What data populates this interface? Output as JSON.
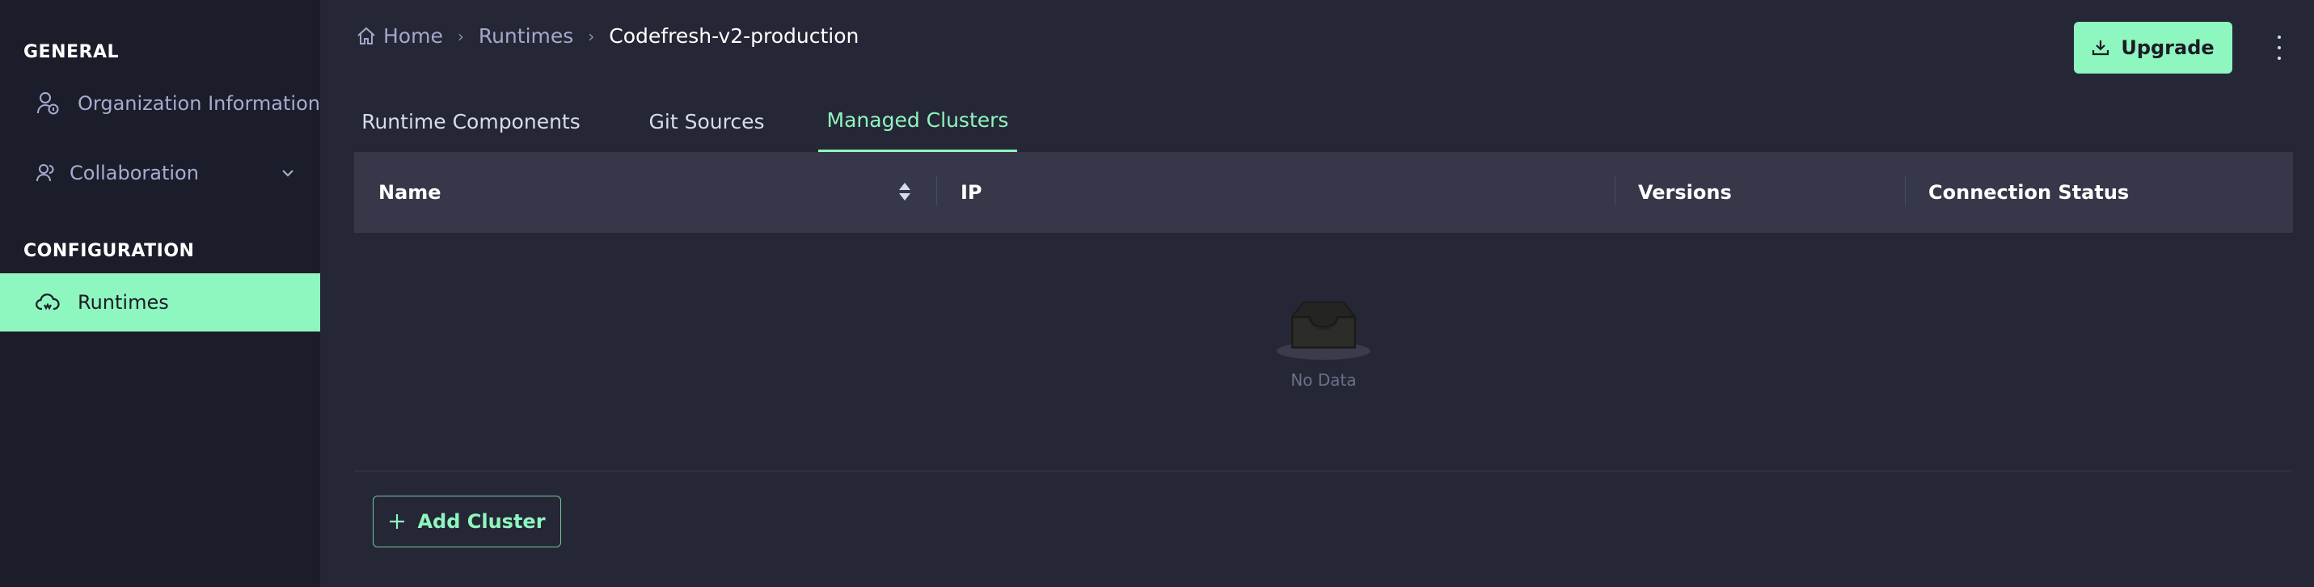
{
  "sidebar": {
    "general_title": "GENERAL",
    "configuration_title": "CONFIGURATION",
    "items": [
      {
        "label": "Organization Information"
      },
      {
        "label": "Collaboration"
      },
      {
        "label": "Runtimes"
      }
    ]
  },
  "breadcrumb": {
    "home": "Home",
    "runtimes": "Runtimes",
    "current": "Codefresh-v2-production"
  },
  "header": {
    "upgrade_label": "Upgrade"
  },
  "tabs": [
    {
      "label": "Runtime Components"
    },
    {
      "label": "Git Sources"
    },
    {
      "label": "Managed Clusters",
      "active": true
    }
  ],
  "table": {
    "columns": [
      "Name",
      "IP",
      "Versions",
      "Connection Status"
    ],
    "rows": [],
    "empty_text": "No Data"
  },
  "actions": {
    "add_cluster_label": "Add Cluster"
  },
  "colors": {
    "accent": "#8ef6bf",
    "sidebar_bg": "#1c1d2a",
    "main_bg": "#262736",
    "table_header_bg": "#363748"
  }
}
